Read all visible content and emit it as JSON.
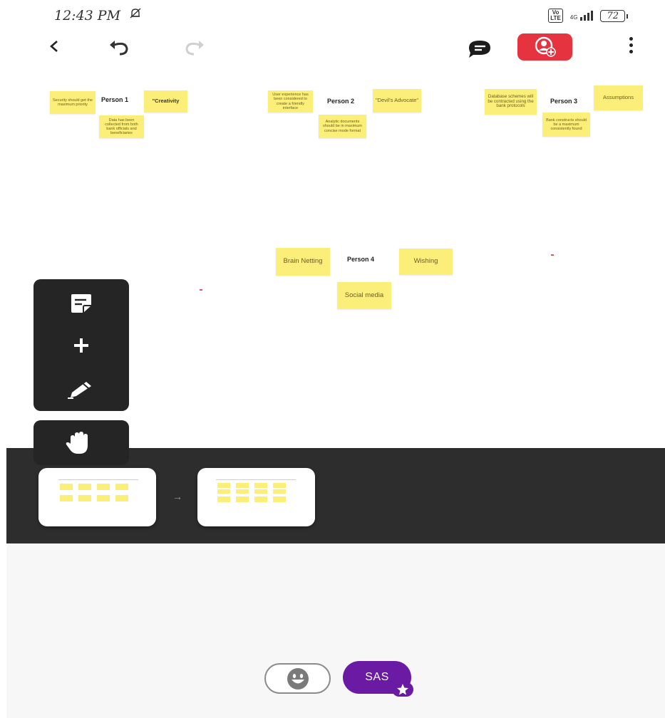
{
  "status_bar": {
    "time": "12:43 PM",
    "volte_top": "Vo",
    "volte_bottom": "LTE",
    "network": "4G",
    "battery": "72"
  },
  "colors": {
    "share_button": "#e5343f",
    "sticky": "#fbef7a",
    "palette_bg": "#252525",
    "avatar": "#6b1aa3"
  },
  "board": {
    "person1": {
      "label": "Person 1",
      "notes": [
        "Security should get the maximum priority",
        "\"Creativity",
        "Data has been collected from both bank officials and beneficiaries"
      ]
    },
    "person2": {
      "label": "Person 2",
      "notes": [
        "User experience has been considered to create a friendly interface",
        "\"Devil's Advocate\"",
        "Analytic documents should be in maximum concise mode format"
      ]
    },
    "person3": {
      "label": "Person 3",
      "notes": [
        "Database schemes will be contracted using the bank protocols",
        "Assumptions",
        "Bank constructs should be a maximum consistently found"
      ]
    },
    "person4": {
      "label": "Person 4",
      "notes": [
        "Brain Netting",
        "Wishing",
        "Social media"
      ]
    }
  },
  "avatar": {
    "initials": "SAS"
  }
}
